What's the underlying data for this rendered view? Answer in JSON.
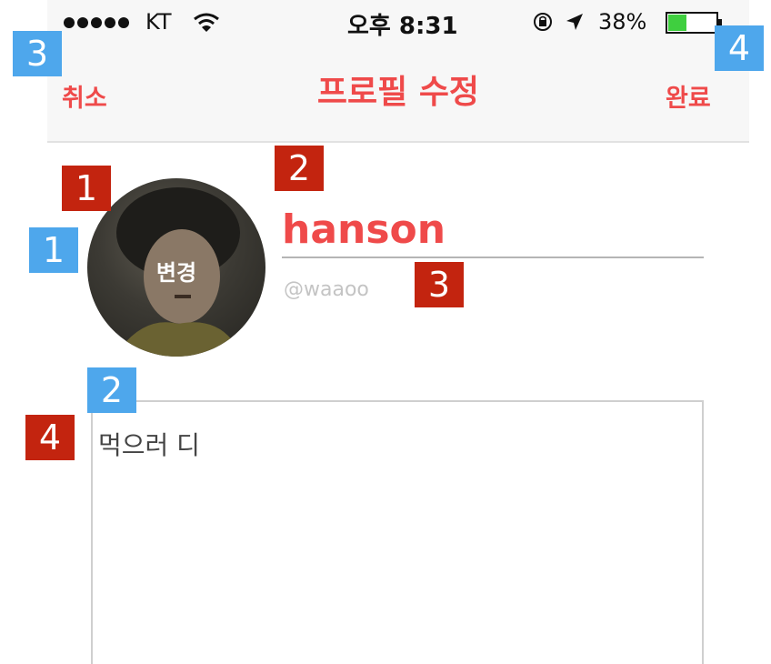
{
  "status_bar": {
    "carrier": "KT",
    "time": "오후 8:31",
    "battery": "38%"
  },
  "nav": {
    "cancel_label": "취소",
    "title": "프로필 수정",
    "done_label": "완료"
  },
  "profile": {
    "avatar_label": "변경",
    "name_value": "hanson",
    "username": "@waaoo",
    "bio_value": "먹으러 디"
  },
  "annotations": {
    "blue": [
      "1",
      "2",
      "3",
      "4"
    ],
    "red": [
      "1",
      "2",
      "3",
      "4"
    ]
  },
  "colors": {
    "accent": "#ef4a4a",
    "marker_blue": "#4ea7ec",
    "marker_red": "#c3240f",
    "battery_fill": "#3fcf3f"
  },
  "icons": [
    "wifi-icon",
    "lock-rotation-icon",
    "location-arrow-icon",
    "battery-icon"
  ]
}
